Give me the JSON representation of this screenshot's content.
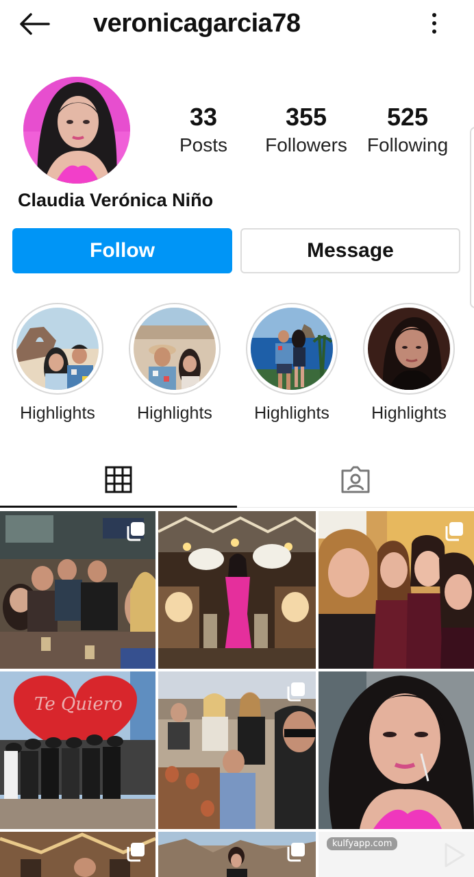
{
  "header": {
    "username": "veronicagarcia78",
    "back_icon": "arrow-left-icon",
    "more_icon": "more-vertical-icon"
  },
  "profile": {
    "display_name": "Claudia Verónica Niño",
    "stats": [
      {
        "value": "33",
        "label": "Posts"
      },
      {
        "value": "355",
        "label": "Followers"
      },
      {
        "value": "525",
        "label": "Following"
      }
    ]
  },
  "actions": {
    "follow_label": "Follow",
    "message_label": "Message",
    "follow_color": "#0095f6"
  },
  "highlights": [
    {
      "label": "Highlights"
    },
    {
      "label": "Highlights"
    },
    {
      "label": "Highlights"
    },
    {
      "label": "Highlights"
    }
  ],
  "tabs": [
    {
      "icon": "grid-icon",
      "active": true
    },
    {
      "icon": "tagged-user-icon",
      "active": false
    }
  ],
  "grid": {
    "watermark": "kulfyapp.com"
  }
}
